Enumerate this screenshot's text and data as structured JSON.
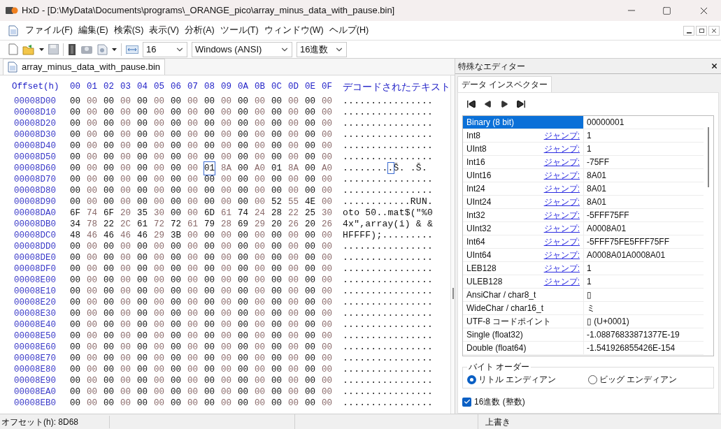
{
  "window": {
    "title": "HxD - [D:\\MyData\\Documents\\programs\\_ORANGE_pico\\array_minus_data_with_pause.bin]"
  },
  "menu": [
    {
      "label": "ファイル(F)"
    },
    {
      "label": "編集(E)"
    },
    {
      "label": "検索(S)"
    },
    {
      "label": "表示(V)"
    },
    {
      "label": "分析(A)"
    },
    {
      "label": "ツール(T)"
    },
    {
      "label": "ウィンドウ(W)"
    },
    {
      "label": "ヘルプ(H)"
    }
  ],
  "toolbar": {
    "bytes_per_row": "16",
    "encoding": "Windows (ANSI)",
    "number_base": "16進数"
  },
  "document_tab": {
    "label": "array_minus_data_with_pause.bin",
    "selected": true
  },
  "hex": {
    "offset_header": "Offset(h)",
    "text_header": "デコードされたテキスト",
    "columns": [
      {
        "label": "00",
        "selected": false
      },
      {
        "label": "01",
        "selected": false
      },
      {
        "label": "02",
        "selected": false
      },
      {
        "label": "03",
        "selected": false
      },
      {
        "label": "04",
        "selected": false
      },
      {
        "label": "05",
        "selected": false
      },
      {
        "label": "06",
        "selected": false
      },
      {
        "label": "07",
        "selected": false
      },
      {
        "label": "08",
        "selected": true
      },
      {
        "label": "09",
        "selected": false
      },
      {
        "label": "0A",
        "selected": false
      },
      {
        "label": "0B",
        "selected": false
      },
      {
        "label": "0C",
        "selected": false
      },
      {
        "label": "0D",
        "selected": false
      },
      {
        "label": "0E",
        "selected": false
      },
      {
        "label": "0F",
        "selected": false
      }
    ],
    "rows": [
      {
        "offset": "00008D00",
        "selected": false,
        "bytes": [
          "00",
          "00",
          "00",
          "00",
          "00",
          "00",
          "00",
          "00",
          "00",
          "00",
          "00",
          "00",
          "00",
          "00",
          "00",
          "00"
        ],
        "text": "................"
      },
      {
        "offset": "00008D10",
        "selected": false,
        "bytes": [
          "00",
          "00",
          "00",
          "00",
          "00",
          "00",
          "00",
          "00",
          "00",
          "00",
          "00",
          "00",
          "00",
          "00",
          "00",
          "00"
        ],
        "text": "................"
      },
      {
        "offset": "00008D20",
        "selected": false,
        "bytes": [
          "00",
          "00",
          "00",
          "00",
          "00",
          "00",
          "00",
          "00",
          "00",
          "00",
          "00",
          "00",
          "00",
          "00",
          "00",
          "00"
        ],
        "text": "................"
      },
      {
        "offset": "00008D30",
        "selected": false,
        "bytes": [
          "00",
          "00",
          "00",
          "00",
          "00",
          "00",
          "00",
          "00",
          "00",
          "00",
          "00",
          "00",
          "00",
          "00",
          "00",
          "00"
        ],
        "text": "................"
      },
      {
        "offset": "00008D40",
        "selected": false,
        "bytes": [
          "00",
          "00",
          "00",
          "00",
          "00",
          "00",
          "00",
          "00",
          "00",
          "00",
          "00",
          "00",
          "00",
          "00",
          "00",
          "00"
        ],
        "text": "................"
      },
      {
        "offset": "00008D50",
        "selected": false,
        "bytes": [
          "00",
          "00",
          "00",
          "00",
          "00",
          "00",
          "00",
          "00",
          "00",
          "00",
          "00",
          "00",
          "00",
          "00",
          "00",
          "00"
        ],
        "text": "................"
      },
      {
        "offset": "00008D60",
        "selected": true,
        "bytes": [
          "00",
          "00",
          "00",
          "00",
          "00",
          "00",
          "00",
          "00",
          "01",
          "8A",
          "00",
          "A0",
          "01",
          "8A",
          "00",
          "A0"
        ],
        "text": ".........Š. .Š."
      },
      {
        "offset": "00008D70",
        "selected": false,
        "bytes": [
          "00",
          "00",
          "00",
          "00",
          "00",
          "00",
          "00",
          "00",
          "00",
          "00",
          "00",
          "00",
          "00",
          "00",
          "00",
          "00"
        ],
        "text": "................"
      },
      {
        "offset": "00008D80",
        "selected": false,
        "bytes": [
          "00",
          "00",
          "00",
          "00",
          "00",
          "00",
          "00",
          "00",
          "00",
          "00",
          "00",
          "00",
          "00",
          "00",
          "00",
          "00"
        ],
        "text": "................"
      },
      {
        "offset": "00008D90",
        "selected": false,
        "bytes": [
          "00",
          "00",
          "00",
          "00",
          "00",
          "00",
          "00",
          "00",
          "00",
          "00",
          "00",
          "00",
          "52",
          "55",
          "4E",
          "00"
        ],
        "text": "............RUN."
      },
      {
        "offset": "00008DA0",
        "selected": false,
        "bytes": [
          "6F",
          "74",
          "6F",
          "20",
          "35",
          "30",
          "00",
          "00",
          "6D",
          "61",
          "74",
          "24",
          "28",
          "22",
          "25",
          "30"
        ],
        "text": "oto 50..mat$(\"%0"
      },
      {
        "offset": "00008DB0",
        "selected": false,
        "bytes": [
          "34",
          "78",
          "22",
          "2C",
          "61",
          "72",
          "72",
          "61",
          "79",
          "28",
          "69",
          "29",
          "20",
          "26",
          "20",
          "26"
        ],
        "text": "4x\",array(i) & &"
      },
      {
        "offset": "00008DC0",
        "selected": false,
        "bytes": [
          "48",
          "46",
          "46",
          "46",
          "46",
          "29",
          "3B",
          "00",
          "00",
          "00",
          "00",
          "00",
          "00",
          "00",
          "00",
          "00"
        ],
        "text": "HFFFF);........."
      },
      {
        "offset": "00008DD0",
        "selected": false,
        "bytes": [
          "00",
          "00",
          "00",
          "00",
          "00",
          "00",
          "00",
          "00",
          "00",
          "00",
          "00",
          "00",
          "00",
          "00",
          "00",
          "00"
        ],
        "text": "................"
      },
      {
        "offset": "00008DE0",
        "selected": false,
        "bytes": [
          "00",
          "00",
          "00",
          "00",
          "00",
          "00",
          "00",
          "00",
          "00",
          "00",
          "00",
          "00",
          "00",
          "00",
          "00",
          "00"
        ],
        "text": "................"
      },
      {
        "offset": "00008DF0",
        "selected": false,
        "bytes": [
          "00",
          "00",
          "00",
          "00",
          "00",
          "00",
          "00",
          "00",
          "00",
          "00",
          "00",
          "00",
          "00",
          "00",
          "00",
          "00"
        ],
        "text": "................"
      },
      {
        "offset": "00008E00",
        "selected": false,
        "bytes": [
          "00",
          "00",
          "00",
          "00",
          "00",
          "00",
          "00",
          "00",
          "00",
          "00",
          "00",
          "00",
          "00",
          "00",
          "00",
          "00"
        ],
        "text": "................"
      },
      {
        "offset": "00008E10",
        "selected": false,
        "bytes": [
          "00",
          "00",
          "00",
          "00",
          "00",
          "00",
          "00",
          "00",
          "00",
          "00",
          "00",
          "00",
          "00",
          "00",
          "00",
          "00"
        ],
        "text": "................"
      },
      {
        "offset": "00008E20",
        "selected": false,
        "bytes": [
          "00",
          "00",
          "00",
          "00",
          "00",
          "00",
          "00",
          "00",
          "00",
          "00",
          "00",
          "00",
          "00",
          "00",
          "00",
          "00"
        ],
        "text": "................"
      },
      {
        "offset": "00008E30",
        "selected": false,
        "bytes": [
          "00",
          "00",
          "00",
          "00",
          "00",
          "00",
          "00",
          "00",
          "00",
          "00",
          "00",
          "00",
          "00",
          "00",
          "00",
          "00"
        ],
        "text": "................"
      },
      {
        "offset": "00008E40",
        "selected": false,
        "bytes": [
          "00",
          "00",
          "00",
          "00",
          "00",
          "00",
          "00",
          "00",
          "00",
          "00",
          "00",
          "00",
          "00",
          "00",
          "00",
          "00"
        ],
        "text": "................"
      },
      {
        "offset": "00008E50",
        "selected": false,
        "bytes": [
          "00",
          "00",
          "00",
          "00",
          "00",
          "00",
          "00",
          "00",
          "00",
          "00",
          "00",
          "00",
          "00",
          "00",
          "00",
          "00"
        ],
        "text": "................"
      },
      {
        "offset": "00008E60",
        "selected": false,
        "bytes": [
          "00",
          "00",
          "00",
          "00",
          "00",
          "00",
          "00",
          "00",
          "00",
          "00",
          "00",
          "00",
          "00",
          "00",
          "00",
          "00"
        ],
        "text": "................"
      },
      {
        "offset": "00008E70",
        "selected": false,
        "bytes": [
          "00",
          "00",
          "00",
          "00",
          "00",
          "00",
          "00",
          "00",
          "00",
          "00",
          "00",
          "00",
          "00",
          "00",
          "00",
          "00"
        ],
        "text": "................"
      },
      {
        "offset": "00008E80",
        "selected": false,
        "bytes": [
          "00",
          "00",
          "00",
          "00",
          "00",
          "00",
          "00",
          "00",
          "00",
          "00",
          "00",
          "00",
          "00",
          "00",
          "00",
          "00"
        ],
        "text": "................"
      },
      {
        "offset": "00008E90",
        "selected": false,
        "bytes": [
          "00",
          "00",
          "00",
          "00",
          "00",
          "00",
          "00",
          "00",
          "00",
          "00",
          "00",
          "00",
          "00",
          "00",
          "00",
          "00"
        ],
        "text": "................"
      },
      {
        "offset": "00008EA0",
        "selected": false,
        "bytes": [
          "00",
          "00",
          "00",
          "00",
          "00",
          "00",
          "00",
          "00",
          "00",
          "00",
          "00",
          "00",
          "00",
          "00",
          "00",
          "00"
        ],
        "text": "................"
      },
      {
        "offset": "00008EB0",
        "selected": false,
        "bytes": [
          "00",
          "00",
          "00",
          "00",
          "00",
          "00",
          "00",
          "00",
          "00",
          "00",
          "00",
          "00",
          "00",
          "00",
          "00",
          "00"
        ],
        "text": "................"
      }
    ]
  },
  "inspector": {
    "panel_title": "特殊なエディター",
    "tab": {
      "label": "データ インスペクター",
      "selected": true
    },
    "rows": [
      {
        "name": "Binary (8 bit)",
        "value": "00000001",
        "selected": true
      },
      {
        "name": "Int8",
        "jump": "ジャンプ:",
        "value": "1",
        "selected": false
      },
      {
        "name": "UInt8",
        "jump": "ジャンプ:",
        "value": "1",
        "selected": false
      },
      {
        "name": "Int16",
        "jump": "ジャンプ:",
        "value": "-75FF",
        "selected": false
      },
      {
        "name": "UInt16",
        "jump": "ジャンプ:",
        "value": "8A01",
        "selected": false
      },
      {
        "name": "Int24",
        "jump": "ジャンプ:",
        "value": "8A01",
        "selected": false
      },
      {
        "name": "UInt24",
        "jump": "ジャンプ:",
        "value": "8A01",
        "selected": false
      },
      {
        "name": "Int32",
        "jump": "ジャンプ:",
        "value": "-5FFF75FF",
        "selected": false
      },
      {
        "name": "UInt32",
        "jump": "ジャンプ:",
        "value": "A0008A01",
        "selected": false
      },
      {
        "name": "Int64",
        "jump": "ジャンプ:",
        "value": "-5FFF75FE5FFF75FF",
        "selected": false
      },
      {
        "name": "UInt64",
        "jump": "ジャンプ:",
        "value": "A0008A01A0008A01",
        "selected": false
      },
      {
        "name": "LEB128",
        "jump": "ジャンプ:",
        "value": "1",
        "selected": false
      },
      {
        "name": "ULEB128",
        "jump": "ジャンプ:",
        "value": "1",
        "selected": false
      },
      {
        "name": "AnsiChar / char8_t",
        "value": "▯",
        "selected": false
      },
      {
        "name": "WideChar / char16_t",
        "value": "ミ",
        "selected": false
      },
      {
        "name": "UTF-8 コードポイント",
        "value": "▯ (U+0001)",
        "selected": false
      },
      {
        "name": "Single (float32)",
        "value": "-1.08876833871377E-19",
        "selected": false
      },
      {
        "name": "Double (float64)",
        "value": "-1.541926855426E-154",
        "selected": false
      }
    ],
    "byte_order": {
      "legend": "バイト オーダー",
      "options": [
        {
          "label": "リトル エンディアン",
          "selected": true
        },
        {
          "label": "ビッグ エンディアン",
          "selected": false
        }
      ]
    },
    "hex_integers": {
      "label": "16進数 (整数)",
      "checked": true
    }
  },
  "status_bar": {
    "offset": "オフセット(h): 8D68",
    "mode": "上書き"
  }
}
